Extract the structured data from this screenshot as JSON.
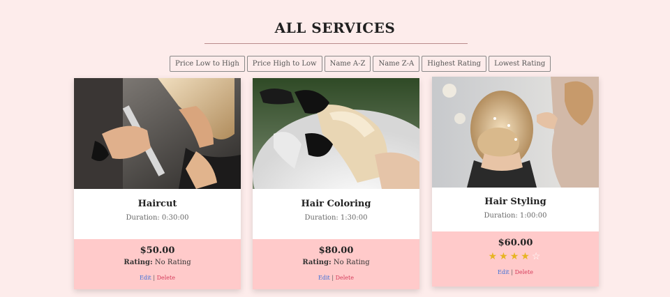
{
  "page": {
    "title": "ALL SERVICES"
  },
  "sort_buttons": [
    "Price Low to High",
    "Price High to Low",
    "Name A-Z",
    "Name Z-A",
    "Highest Rating",
    "Lowest Rating"
  ],
  "services": [
    {
      "name": "Haircut",
      "duration": "Duration: 0:30:00",
      "price": "$50.00",
      "rating_label": "Rating:",
      "rating_value": "No Rating",
      "edit_label": "Edit",
      "separator": "|",
      "delete_label": "Delete"
    },
    {
      "name": "Hair Coloring",
      "duration": "Duration: 1:30:00",
      "price": "$80.00",
      "rating_label": "Rating:",
      "rating_value": "No Rating",
      "edit_label": "Edit",
      "separator": "|",
      "delete_label": "Delete"
    },
    {
      "name": "Hair Styling",
      "duration": "Duration: 1:00:00",
      "price": "$60.00",
      "stars": 4,
      "stars_max": 5,
      "edit_label": "Edit",
      "separator": "|",
      "delete_label": "Delete"
    }
  ],
  "colors": {
    "background": "#fdeceb",
    "card_footer": "#ffcaca",
    "star": "#e6b422",
    "edit_link": "#3b6fd8",
    "delete_link": "#d63b5a"
  },
  "images": [
    "haircut-photo",
    "hair-coloring-photo",
    "hair-styling-photo"
  ]
}
